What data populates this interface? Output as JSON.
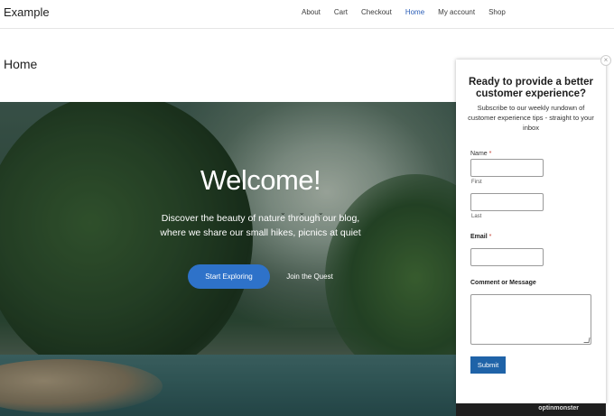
{
  "header": {
    "site_title": "Example",
    "nav": [
      {
        "label": "About"
      },
      {
        "label": "Cart"
      },
      {
        "label": "Checkout"
      },
      {
        "label": "Home",
        "active": true
      },
      {
        "label": "My account"
      },
      {
        "label": "Shop"
      }
    ],
    "active_color": "#2b5eb7"
  },
  "page": {
    "title": "Home"
  },
  "hero": {
    "heading": "Welcome!",
    "tagline_line1": "Discover the beauty of nature through our blog,",
    "tagline_line2": "where we share our small hikes, picnics at quiet",
    "primary_button": "Start Exploring",
    "secondary_button": "Join the Quest",
    "primary_color": "#2e72c9"
  },
  "popup": {
    "close_icon": "close-icon",
    "close_glyph": "×",
    "title": "Ready to provide a better customer experience?",
    "subtitle": "Subscribe to our weekly rundown of customer experience tips - straight to your inbox",
    "name_label": "Name",
    "required_marker": "*",
    "first_label": "First",
    "last_label": "Last",
    "email_label": "Email",
    "comment_label": "Comment or Message",
    "submit_label": "Submit",
    "submit_color": "#1f63a8",
    "brand": "optinmonster"
  }
}
